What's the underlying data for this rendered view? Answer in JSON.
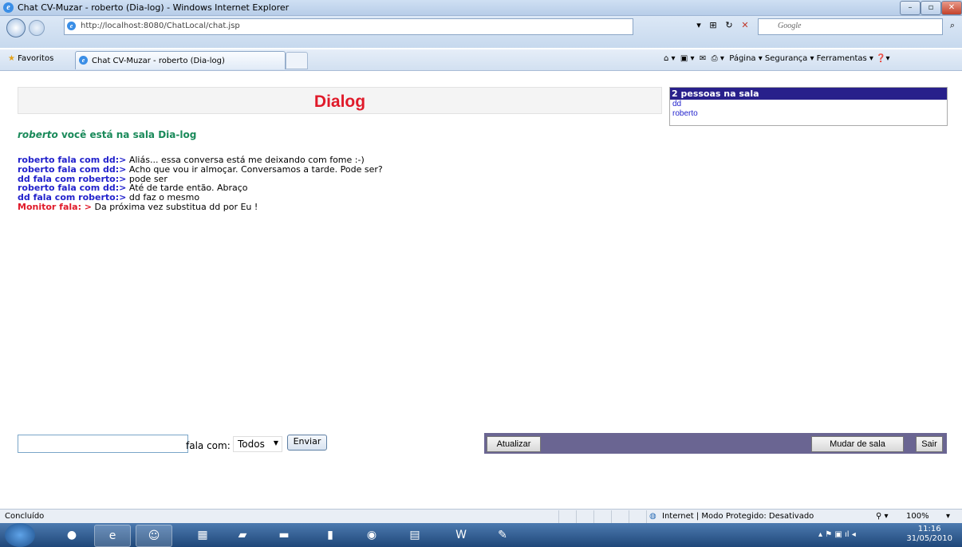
{
  "window": {
    "title": "Chat CV-Muzar - roberto (Dia-log) - Windows Internet Explorer",
    "controls": {
      "minimize": "–",
      "restore": "▫",
      "close": "✕"
    }
  },
  "address_bar": {
    "url": "http://localhost:8080/ChatLocal/chat.jsp",
    "search_placeholder": "Google"
  },
  "tabs_row": {
    "favorites_label": "Favoritos",
    "tab_title": "Chat CV-Muzar - roberto (Dia-log)",
    "menu": "Página ▾   Segurança ▾   Ferramentas ▾"
  },
  "page": {
    "header_title": "Dialog",
    "users": {
      "count_label": "2 pessoas na sala",
      "list": [
        "dd",
        "roberto"
      ]
    },
    "welcome": {
      "user": "roberto",
      "text": " você está na sala Dia-log"
    },
    "messages": [
      {
        "speaker": "roberto fala com dd:>",
        "text": " Aliás... essa conversa está me deixando com fome :-)",
        "type": "user"
      },
      {
        "speaker": "roberto fala com dd:>",
        "text": " Acho que vou ir almoçar. Conversamos a tarde. Pode ser?",
        "type": "user"
      },
      {
        "speaker": "dd fala com roberto:>",
        "text": " pode ser",
        "type": "user"
      },
      {
        "speaker": "roberto fala com dd:>",
        "text": " Até de tarde então. Abraço",
        "type": "user"
      },
      {
        "speaker": "dd fala com roberto:>",
        "text": " dd faz o mesmo",
        "type": "user"
      },
      {
        "speaker": "Monitor fala: >",
        "text": " Da próxima vez substitua dd por Eu !",
        "type": "monitor"
      }
    ],
    "composer": {
      "input_value": "",
      "fala_com_label": "fala com:",
      "recipient_selected": "Todos",
      "send_label": "Enviar"
    },
    "actions": {
      "refresh_label": "Atualizar",
      "change_room_label": "Mudar de sala",
      "exit_label": "Sair"
    }
  },
  "status_bar": {
    "status": "Concluído",
    "zone": "Internet | Modo Protegido: Desativado",
    "zoom": "100%"
  },
  "taskbar": {
    "time": "11:16",
    "date": "31/05/2010"
  },
  "colors": {
    "title_red": "#e01a2a",
    "users_header_bg": "#28208b",
    "speaker_blue": "#2222cc",
    "welcome_green": "#1a8a5a",
    "action_bar_bg": "#6a6592"
  }
}
